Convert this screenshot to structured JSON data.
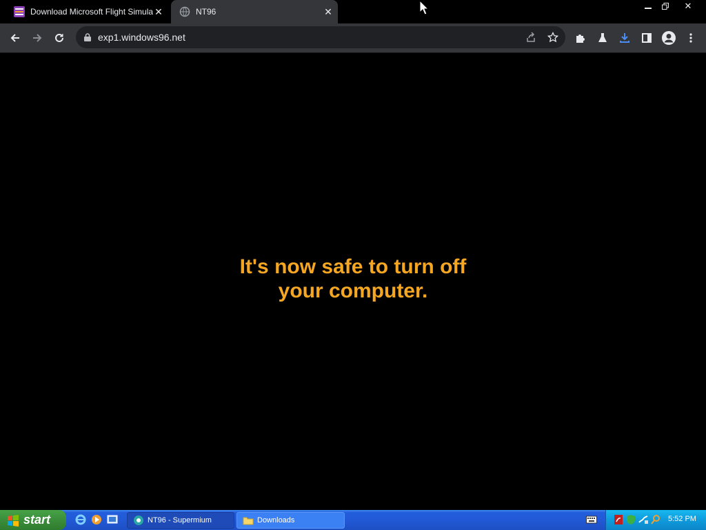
{
  "browser": {
    "tabs": [
      {
        "title": "Download Microsoft Flight Simulator",
        "active": false
      },
      {
        "title": "NT96",
        "active": true
      }
    ],
    "url": "exp1.windows96.net"
  },
  "page": {
    "message_line1": "It's now safe to turn off",
    "message_line2": "your computer.",
    "message_color": "#f5a623"
  },
  "taskbar": {
    "start_label": "start",
    "tasks": [
      {
        "label": "NT96 - Supermium",
        "icon": "supermium-icon"
      },
      {
        "label": "Downloads",
        "icon": "folder-icon"
      }
    ],
    "clock": "5:52 PM"
  }
}
